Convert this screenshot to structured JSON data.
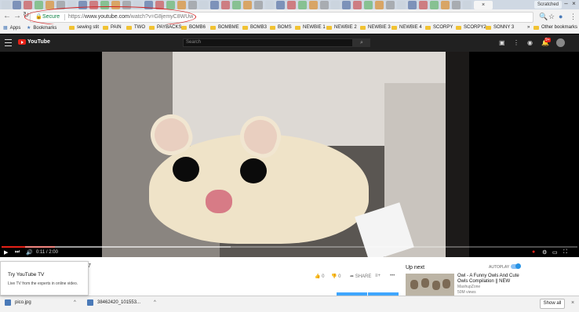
{
  "browser": {
    "user_badge": "Scratched",
    "active_tab_glyph": "×",
    "omnibox": {
      "secure_label": "Secure",
      "url_prefix": "https://",
      "url_host": "www.youtube.com",
      "url_path": "/watch?v=G8jemyC8WUw"
    },
    "bookmarks": [
      {
        "label": "Apps",
        "icon": "apps-icon"
      },
      {
        "label": "Bookmarks",
        "icon": "star-icon"
      },
      {
        "label": "sewing stit",
        "icon": "folder-icon"
      },
      {
        "label": "PAIN",
        "icon": "folder-icon"
      },
      {
        "label": "TWO",
        "icon": "folder-icon"
      },
      {
        "label": "PAYBACKS",
        "icon": "folder-icon"
      },
      {
        "label": "BOMB6",
        "icon": "folder-icon"
      },
      {
        "label": "BOMBME",
        "icon": "folder-icon"
      },
      {
        "label": "BOMB3",
        "icon": "folder-icon"
      },
      {
        "label": "BOMS",
        "icon": "folder-icon"
      },
      {
        "label": "NEWBIE 1",
        "icon": "folder-icon"
      },
      {
        "label": "NEWBIE 2",
        "icon": "folder-icon"
      },
      {
        "label": "NEWBIE 3",
        "icon": "folder-icon"
      },
      {
        "label": "NEWBIE 4",
        "icon": "folder-icon"
      },
      {
        "label": "SCORPY",
        "icon": "folder-icon"
      },
      {
        "label": "SCORPY2",
        "icon": "folder-icon"
      },
      {
        "label": "SONNY 3",
        "icon": "folder-icon"
      }
    ],
    "more_bookmarks": "»",
    "other_bookmarks": "Other bookmarks"
  },
  "youtube": {
    "logo_text": "YouTube",
    "search_placeholder": "Search",
    "notification_count": "9+",
    "player": {
      "time": "0:11 / 2:00",
      "progress_fraction": 0.092
    },
    "count_fragment": "7",
    "likes": "0",
    "dislikes": "0",
    "share_label": "SHARE",
    "more_label": "•••",
    "up_next_label": "Up next",
    "autoplay_label": "AUTOPLAY",
    "recommendation": {
      "title": "Owl - A Funny Owls And Cute Owls Compilation || NEW",
      "channel": "MashupZone",
      "views": "50M views"
    },
    "try_tv": {
      "title": "Try YouTube TV",
      "body": "Live TV from the experts in online video."
    }
  },
  "downloads": {
    "items": [
      {
        "name": "pico.jpg"
      },
      {
        "name": "38462420_101553..."
      }
    ],
    "show_all": "Show all"
  },
  "colors": {
    "youtube_red": "#e62117",
    "annotation_circle": "#d42020",
    "secure_green": "#0b8043"
  }
}
